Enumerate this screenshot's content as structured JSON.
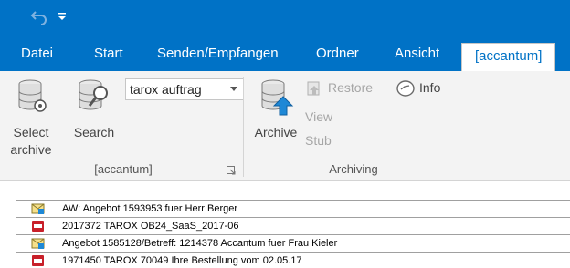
{
  "tabs": [
    {
      "label": "Datei"
    },
    {
      "label": "Start"
    },
    {
      "label": "Senden/Empfangen"
    },
    {
      "label": "Ordner"
    },
    {
      "label": "Ansicht"
    },
    {
      "label": "[accantum]",
      "active": true
    }
  ],
  "ribbon": {
    "select_archive": {
      "line1": "Select",
      "line2": "archive"
    },
    "search": {
      "label": "Search"
    },
    "search_combo": {
      "value": "tarox auftrag"
    },
    "archive": {
      "label": "Archive"
    },
    "restore": {
      "label": "Restore",
      "enabled": false
    },
    "view_stub": {
      "line1": "View",
      "line2": "Stub",
      "enabled": false
    },
    "info": {
      "label": "Info"
    },
    "groups": [
      {
        "label": "[accantum]"
      },
      {
        "label": "Archiving"
      }
    ]
  },
  "messages": [
    {
      "icon": "archived-mail-icon",
      "subject": "AW: Angebot 1593953 fuer Herr Berger"
    },
    {
      "icon": "pdf-icon",
      "subject": "2017372 TAROX OB24_SaaS_2017-06"
    },
    {
      "icon": "archived-mail-icon",
      "subject": "Angebot 1585128/Betreff: 1214378 Accantum fuer Frau Kieler"
    },
    {
      "icon": "pdf-icon",
      "subject": "1971450 TAROX 70049 Ihre Bestellung vom 02.05.17"
    }
  ],
  "colors": {
    "accent": "#0072c6",
    "ribbon_bg": "#f3f3f3",
    "disabled_text": "#a6a6a6",
    "pdf_red": "#c8202a"
  }
}
